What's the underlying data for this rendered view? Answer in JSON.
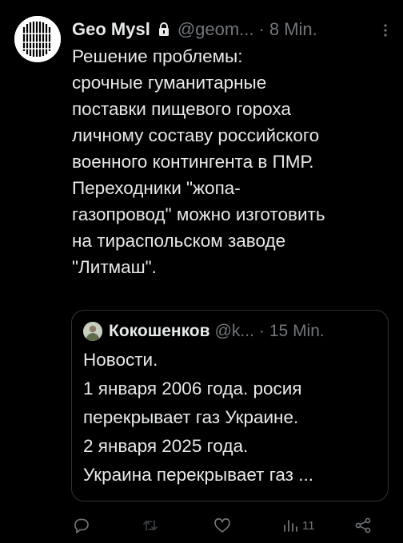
{
  "tweet": {
    "author_name": "Geo Mysl",
    "handle": "@geom...",
    "separator": "·",
    "time": "8 Min.",
    "text_lines": [
      "Решение проблемы:",
      "срочные гуманитарные",
      "поставки пищевого гороха",
      "личному составу российского",
      "военного контингента в ПМР.",
      "Переходники \"жопа-",
      "газопровод\" можно изготовить",
      "на тираспольском заводе",
      "\"Литмаш\"."
    ],
    "icons": {
      "avatar": "striped-pattern-avatar",
      "lock": "lock-icon",
      "more": "more-icon"
    }
  },
  "quoted_tweet": {
    "author_name": "Кокошенков",
    "handle": "@k...",
    "separator": "·",
    "time": "15 Min.",
    "text_lines": [
      "Новости.",
      "1 января 2006 года. росия",
      "перекрывает газ Украине.",
      "2 января 2025 года.",
      "Украина перекрывает газ ..."
    ]
  },
  "actions": {
    "reply": "reply-icon",
    "retweet": "retweet-icon",
    "like": "like-icon",
    "views_count": "11",
    "share": "share-icon"
  },
  "colors": {
    "background": "#000000",
    "primary_text": "#e7e9ea",
    "secondary_text": "#71767b",
    "border": "#2f3336"
  }
}
